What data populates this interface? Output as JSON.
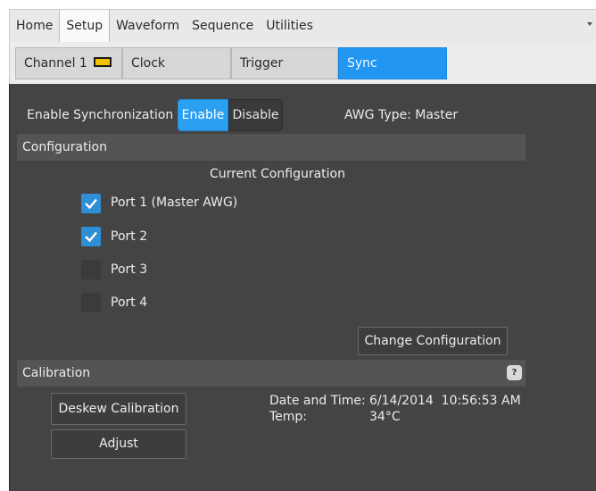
{
  "menu": {
    "items": [
      "Home",
      "Setup",
      "Waveform",
      "Sequence",
      "Utilities"
    ],
    "active": "Setup"
  },
  "tabs": {
    "channel": "Channel 1",
    "clock": "Clock",
    "trigger": "Trigger",
    "sync": "Sync",
    "active": "Sync",
    "channel_indicator_color": "#f2c400"
  },
  "sync": {
    "enable_label": "Enable Synchronization",
    "enable_button": "Enable",
    "disable_button": "Disable",
    "awg_type": "AWG Type: Master"
  },
  "configuration": {
    "section_title": "Configuration",
    "current_title": "Current Configuration",
    "ports": [
      {
        "label": "Port 1 (Master AWG)",
        "checked": true
      },
      {
        "label": "Port 2",
        "checked": true
      },
      {
        "label": "Port 3",
        "checked": false
      },
      {
        "label": "Port 4",
        "checked": false
      }
    ],
    "change_button": "Change Configuration"
  },
  "calibration": {
    "section_title": "Calibration",
    "help": "?",
    "deskew_button": "Deskew Calibration",
    "adjust_button": "Adjust",
    "date_label": "Date and Time:",
    "date_value": "6/14/2014  10:56:53 AM",
    "temp_label": "Temp:",
    "temp_value": "34°C"
  },
  "colors": {
    "accent": "#2196f3",
    "panel": "#444444",
    "checkbox_checked": "#2e8fd6"
  }
}
